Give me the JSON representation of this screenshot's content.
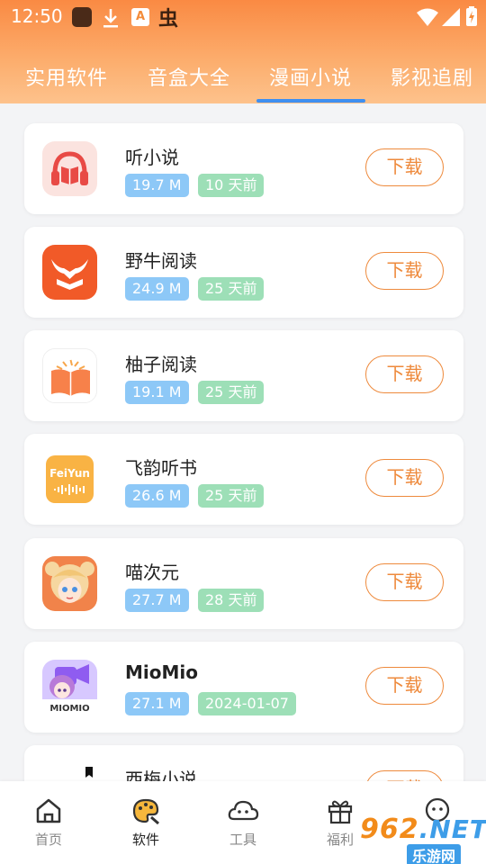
{
  "status_bar": {
    "time": "12:50",
    "a_badge": "A",
    "bug_glyph": "虫"
  },
  "tabs": [
    {
      "label": "实用软件",
      "active": false
    },
    {
      "label": "音盒大全",
      "active": false
    },
    {
      "label": "漫画小说",
      "active": true
    },
    {
      "label": "影视追剧",
      "active": false
    }
  ],
  "download_label": "下载",
  "apps": [
    {
      "name": "听小说",
      "size": "19.7 M",
      "date": "10 天前",
      "icon": "headphone-book-icon"
    },
    {
      "name": "野牛阅读",
      "size": "24.9 M",
      "date": "25 天前",
      "icon": "bull-book-icon"
    },
    {
      "name": "柚子阅读",
      "size": "19.1 M",
      "date": "25 天前",
      "icon": "open-book-icon"
    },
    {
      "name": "飞韵听书",
      "size": "26.6 M",
      "date": "25 天前",
      "icon": "feiyun-logo-icon",
      "logo_text": "FeiYun"
    },
    {
      "name": "喵次元",
      "size": "27.7 M",
      "date": "28 天前",
      "icon": "anime-girl-icon"
    },
    {
      "name": "MioMio",
      "size": "27.1 M",
      "date": "2024-01-07",
      "icon": "miomio-logo-icon",
      "logo_text": "MIOMIO"
    },
    {
      "name": "西梅小说",
      "size": "",
      "date": "",
      "icon": "ximei-logo-icon",
      "logo_text": "西"
    }
  ],
  "bottom_nav": [
    {
      "label": "首页",
      "icon": "home-icon",
      "active": false
    },
    {
      "label": "软件",
      "icon": "palette-icon",
      "active": true
    },
    {
      "label": "工具",
      "icon": "cloud-face-icon",
      "active": false
    },
    {
      "label": "福利",
      "icon": "gift-icon",
      "active": false
    },
    {
      "label": "",
      "icon": "chat-face-icon",
      "active": false
    }
  ],
  "watermark": {
    "number": "962",
    "net": ".NET",
    "site": "乐游网"
  },
  "colors": {
    "header_orange": "#fa8a43",
    "accent_orange": "#ee8a3c",
    "tab_indicator": "#3f8ff0",
    "size_tag": "#8dc8f7",
    "date_tag": "#9ddfb7"
  }
}
